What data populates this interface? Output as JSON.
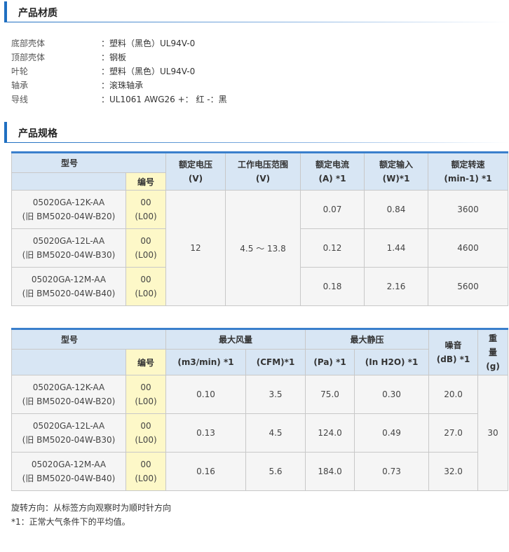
{
  "materials_section": {
    "title": "产品材质",
    "items": [
      {
        "label": "底部壳体",
        "value": "：塑料（黑色）UL94V-0"
      },
      {
        "label": "顶部壳体",
        "value": "：钢板"
      },
      {
        "label": "叶轮",
        "value": "：塑料（黑色）UL94V-0"
      },
      {
        "label": "轴承",
        "value": "：滚珠轴承"
      },
      {
        "label": "导线",
        "value": "：UL1061 AWG26 +： 红 -：黑"
      }
    ]
  },
  "spec_section": {
    "title": "产品规格"
  },
  "table1": {
    "h_model": "型号",
    "h_code": "编号",
    "h_voltage": "额定电压",
    "h_voltage_unit": "(V)",
    "h_range": "工作电压范围",
    "h_range_unit": "(V)",
    "h_current": "额定电流",
    "h_current_unit": "(A) *1",
    "h_input": "额定输入",
    "h_input_unit": "(W)*1",
    "h_speed": "额定转速",
    "h_speed_unit": "(min-1) *1",
    "voltage": "12",
    "range": "4.5 ～ 13.8",
    "rows": [
      {
        "model": "05020GA-12K-AA",
        "old": "(旧 BM5020-04W-B20)",
        "code": "00",
        "code2": "(L00)",
        "current": "0.07",
        "input": "0.84",
        "speed": "3600"
      },
      {
        "model": "05020GA-12L-AA",
        "old": "(旧 BM5020-04W-B30)",
        "code": "00",
        "code2": "(L00)",
        "current": "0.12",
        "input": "1.44",
        "speed": "4600"
      },
      {
        "model": "05020GA-12M-AA",
        "old": "(旧 BM5020-04W-B40)",
        "code": "00",
        "code2": "(L00)",
        "current": "0.18",
        "input": "2.16",
        "speed": "5600"
      }
    ]
  },
  "table2": {
    "h_model": "型号",
    "h_code": "编号",
    "h_airflow": "最大风量",
    "h_airflow_u1": "(m3/min) *1",
    "h_airflow_u2": "(CFM)*1",
    "h_pressure": "最大静压",
    "h_pressure_u1": "(Pa) *1",
    "h_pressure_u2": "(In H2O) *1",
    "h_noise": "噪音",
    "h_noise_unit": "(dB) *1",
    "h_weight": "重量",
    "h_weight_unit": "(g)",
    "weight": "30",
    "rows": [
      {
        "model": "05020GA-12K-AA",
        "old": "(旧 BM5020-04W-B20)",
        "code": "00",
        "code2": "(L00)",
        "m3": "0.10",
        "cfm": "3.5",
        "pa": "75.0",
        "inh2o": "0.30",
        "db": "20.0"
      },
      {
        "model": "05020GA-12L-AA",
        "old": "(旧 BM5020-04W-B30)",
        "code": "00",
        "code2": "(L00)",
        "m3": "0.13",
        "cfm": "4.5",
        "pa": "124.0",
        "inh2o": "0.49",
        "db": "27.0"
      },
      {
        "model": "05020GA-12M-AA",
        "old": "(旧 BM5020-04W-B40)",
        "code": "00",
        "code2": "(L00)",
        "m3": "0.16",
        "cfm": "5.6",
        "pa": "184.0",
        "inh2o": "0.73",
        "db": "32.0"
      }
    ]
  },
  "notes": [
    "旋转方向：从标签方向观察时为顺时针方向",
    "*1：正常大气条件下的平均值。"
  ]
}
